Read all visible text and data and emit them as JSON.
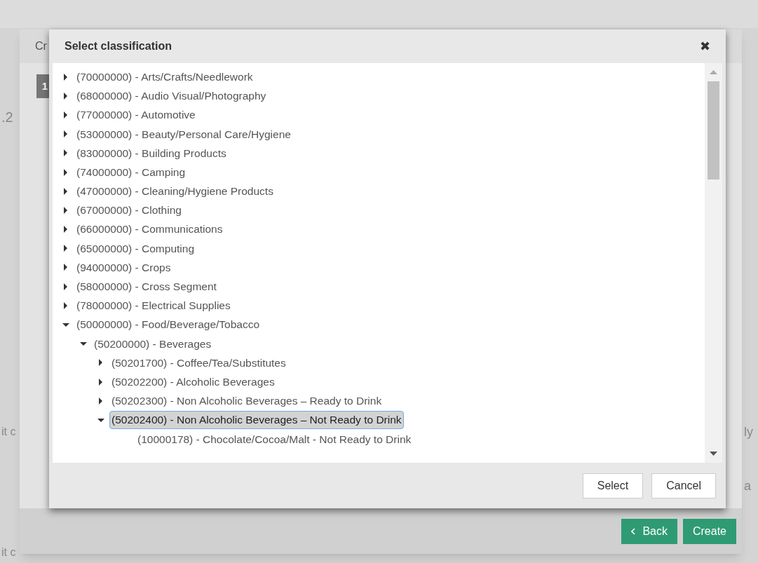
{
  "background": {
    "dialog_title": "Cr",
    "step_badge": "1",
    "fragments": [
      ".2",
      "it c",
      "it c",
      "ly",
      "a"
    ],
    "buttons": [
      {
        "label": "Back",
        "kind": "back"
      },
      {
        "label": "Create",
        "kind": "primary"
      }
    ]
  },
  "dialog": {
    "title": "Select classification",
    "close": "✖",
    "tree": [
      {
        "label": "(70000000) - Arts/Crafts/Needlework",
        "expanded": false,
        "selected": false
      },
      {
        "label": "(68000000) - Audio Visual/Photography",
        "expanded": false,
        "selected": false
      },
      {
        "label": "(77000000) - Automotive",
        "expanded": false,
        "selected": false
      },
      {
        "label": "(53000000) - Beauty/Personal Care/Hygiene",
        "expanded": false,
        "selected": false
      },
      {
        "label": "(83000000) - Building Products",
        "expanded": false,
        "selected": false
      },
      {
        "label": "(74000000) - Camping",
        "expanded": false,
        "selected": false
      },
      {
        "label": "(47000000) - Cleaning/Hygiene Products",
        "expanded": false,
        "selected": false
      },
      {
        "label": "(67000000) - Clothing",
        "expanded": false,
        "selected": false
      },
      {
        "label": "(66000000) - Communications",
        "expanded": false,
        "selected": false
      },
      {
        "label": "(65000000) - Computing",
        "expanded": false,
        "selected": false
      },
      {
        "label": "(94000000) - Crops",
        "expanded": false,
        "selected": false
      },
      {
        "label": "(58000000) - Cross Segment",
        "expanded": false,
        "selected": false
      },
      {
        "label": "(78000000) - Electrical Supplies",
        "expanded": false,
        "selected": false
      },
      {
        "label": "(50000000) - Food/Beverage/Tobacco",
        "expanded": true,
        "selected": false,
        "children": [
          {
            "label": "(50200000) - Beverages",
            "expanded": true,
            "selected": false,
            "children": [
              {
                "label": "(50201700) - Coffee/Tea/Substitutes",
                "expanded": false,
                "selected": false
              },
              {
                "label": "(50202200) - Alcoholic Beverages",
                "expanded": false,
                "selected": false
              },
              {
                "label": "(50202300) - Non Alcoholic Beverages – Ready to Drink",
                "expanded": false,
                "selected": false
              },
              {
                "label": "(50202400) - Non Alcoholic Beverages – Not Ready to Drink",
                "expanded": true,
                "selected": true,
                "children": [
                  {
                    "label": "(10000178) - Chocolate/Cocoa/Malt - Not Ready to Drink",
                    "kind": "leaf",
                    "selected": false
                  }
                ]
              }
            ]
          }
        ]
      }
    ],
    "buttons": [
      {
        "label": "Select"
      },
      {
        "label": "Cancel"
      }
    ]
  }
}
